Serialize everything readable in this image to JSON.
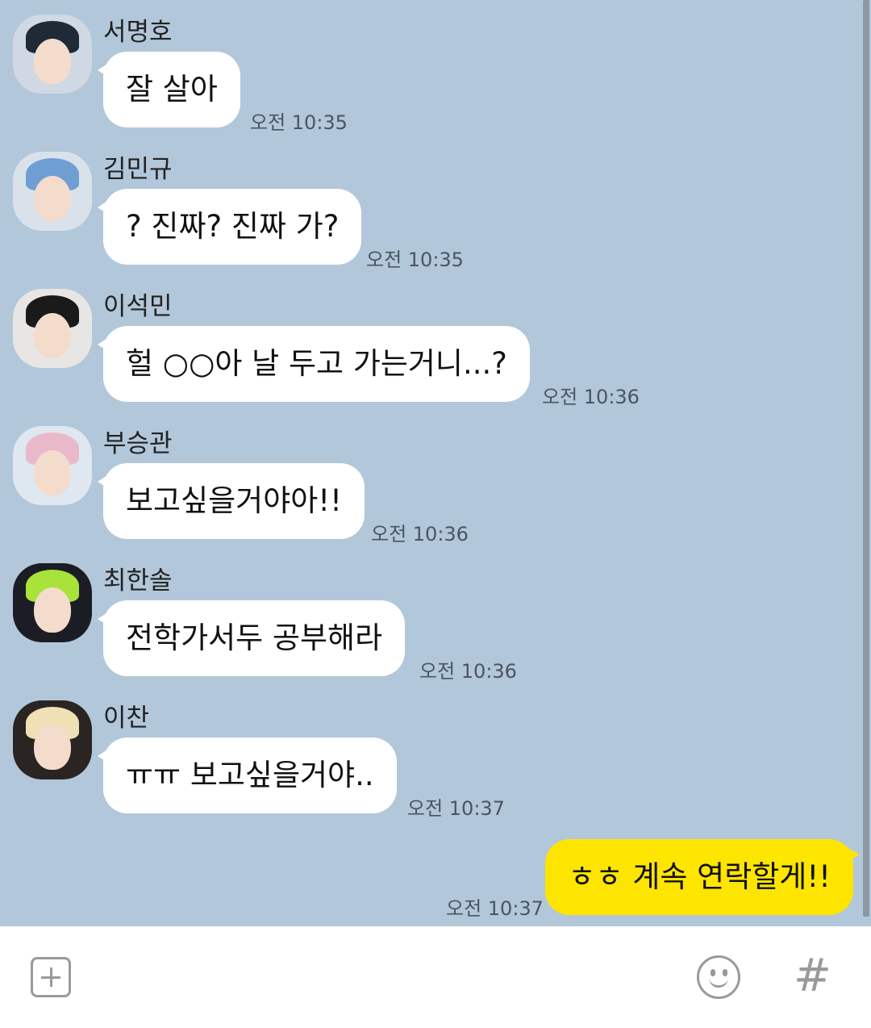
{
  "messages": [
    {
      "sender": "서명호",
      "text": "잘 살아",
      "time": "오전 10:35",
      "avatar_bg": "#cfd8e3",
      "hair_color": "#1f2a36"
    },
    {
      "sender": "김민규",
      "text": "? 진짜? 진짜 가?",
      "time": "오전 10:35",
      "avatar_bg": "#d9e2ea",
      "hair_color": "#6f9ed2"
    },
    {
      "sender": "이석민",
      "text": "헐 ○○아 날 두고 가는거니...?",
      "time": "오전 10:36",
      "avatar_bg": "#e8e6e4",
      "hair_color": "#1a1a1a"
    },
    {
      "sender": "부승관",
      "text": "보고싶을거야아!!",
      "time": "오전 10:36",
      "avatar_bg": "#dfe7f0",
      "hair_color": "#e9b9c9"
    },
    {
      "sender": "최한솔",
      "text": "전학가서두 공부해라",
      "time": "오전 10:36",
      "avatar_bg": "#1c1c24",
      "hair_color": "#a8e23b"
    },
    {
      "sender": "이찬",
      "text": "ㅠㅠ 보고싶을거야..",
      "time": "오전 10:37",
      "avatar_bg": "#2a2522",
      "hair_color": "#efe0b5"
    }
  ],
  "my_message": {
    "text": "ㅎㅎ 계속 연락할게!!",
    "time": "오전 10:37"
  },
  "input_bar": {
    "left_icon": "plus-icon",
    "emoji_icon": "emoji-icon",
    "hash_icon": "hashtag-icon",
    "hash_glyph": "#"
  },
  "colors": {
    "background": "#b2c7da",
    "my_bubble": "#fee500",
    "other_bubble": "#ffffff"
  }
}
